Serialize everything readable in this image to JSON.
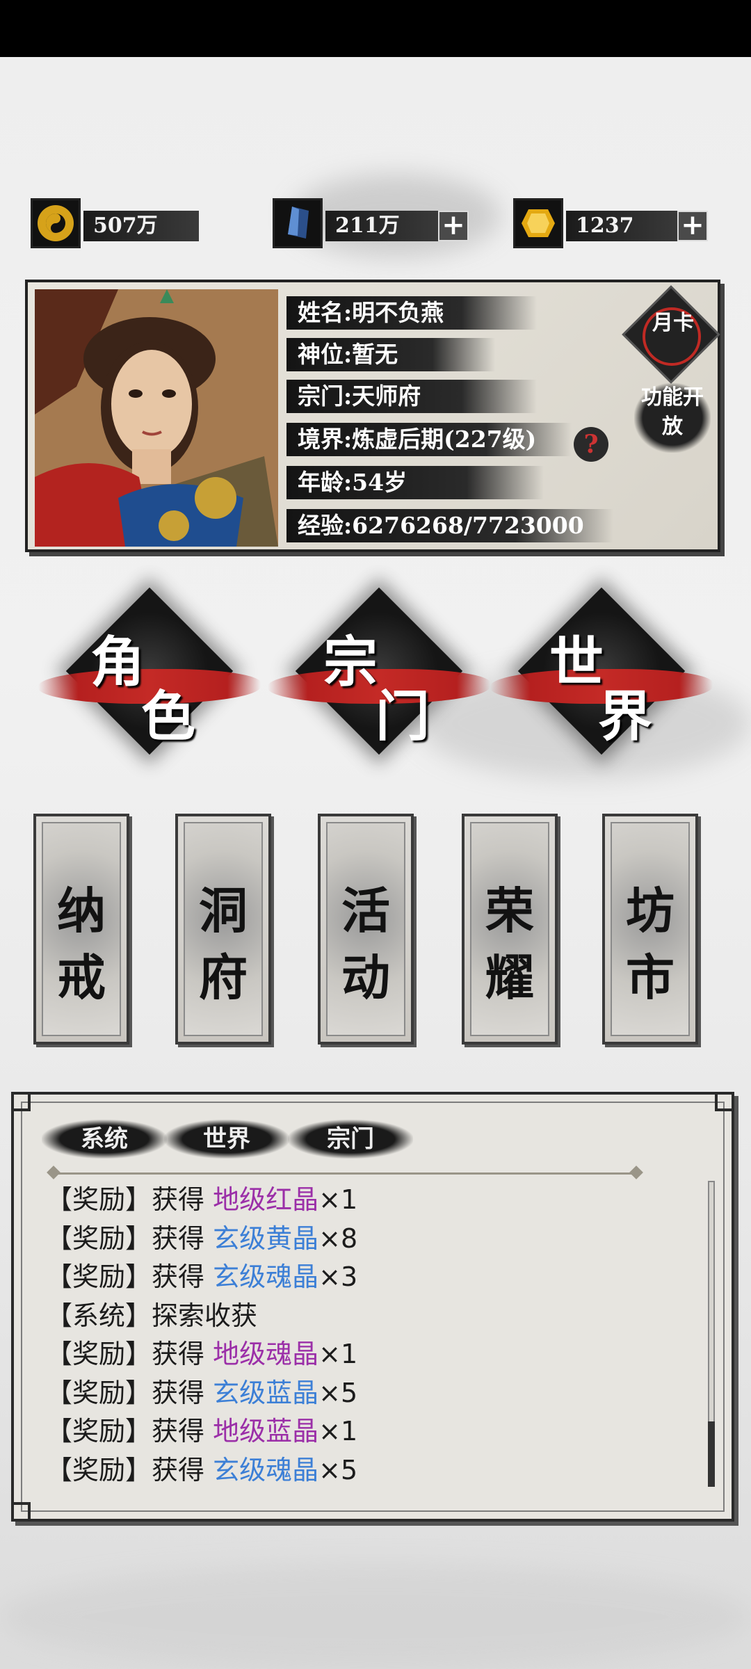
{
  "resources": [
    {
      "icon": "taiji-coin-icon",
      "value": "507万",
      "plus": false
    },
    {
      "icon": "blue-crystal-icon",
      "value": "211万",
      "plus": true
    },
    {
      "icon": "gold-gem-icon",
      "value": "1237",
      "plus": true
    }
  ],
  "resource_plus_symbol": "+",
  "profile": {
    "name": "姓名:明不负燕",
    "divine_rank": "神位:暂无",
    "sect": "宗门:天师府",
    "realm": "境界:炼虚后期(227级)",
    "age": "年龄:54岁",
    "exp": "经验:6276268/7723000",
    "help": "?",
    "month_card": "月卡",
    "function_open": "功能开放"
  },
  "main_menu": [
    {
      "id": "character",
      "top": "角",
      "bottom": "色"
    },
    {
      "id": "sect",
      "top": "宗",
      "bottom": "门"
    },
    {
      "id": "world",
      "top": "世",
      "bottom": "界"
    }
  ],
  "sub_menu": [
    {
      "id": "storage-ring",
      "c1": "纳",
      "c2": "戒"
    },
    {
      "id": "cave-dwelling",
      "c1": "洞",
      "c2": "府"
    },
    {
      "id": "events",
      "c1": "活",
      "c2": "动"
    },
    {
      "id": "glory",
      "c1": "荣",
      "c2": "耀"
    },
    {
      "id": "market",
      "c1": "坊",
      "c2": "市"
    }
  ],
  "chat": {
    "tabs": [
      "系统",
      "世界",
      "宗门"
    ],
    "messages": [
      {
        "tag": "【奖励】",
        "verb": "获得 ",
        "item": "地级红晶",
        "qty": "×1",
        "color": "#9b2fa8"
      },
      {
        "tag": "【奖励】",
        "verb": "获得 ",
        "item": "玄级黄晶",
        "qty": "×8",
        "color": "#3c7fd6"
      },
      {
        "tag": "【奖励】",
        "verb": "获得 ",
        "item": "玄级魂晶",
        "qty": "×3",
        "color": "#3c7fd6"
      },
      {
        "tag": "【系统】",
        "verb": "探索收获",
        "item": "",
        "qty": "",
        "color": "#1c1c1c"
      },
      {
        "tag": "【奖励】",
        "verb": "获得 ",
        "item": "地级魂晶",
        "qty": "×1",
        "color": "#9b2fa8"
      },
      {
        "tag": "【奖励】",
        "verb": "获得 ",
        "item": "玄级蓝晶",
        "qty": "×5",
        "color": "#3c7fd6"
      },
      {
        "tag": "【奖励】",
        "verb": "获得 ",
        "item": "地级蓝晶",
        "qty": "×1",
        "color": "#9b2fa8"
      },
      {
        "tag": "【奖励】",
        "verb": "获得 ",
        "item": "玄级魂晶",
        "qty": "×5",
        "color": "#3c7fd6"
      }
    ]
  },
  "colors": {
    "earth_grade": "#9b2fa8",
    "mystic_grade": "#3c7fd6",
    "accent_red": "#c42a26"
  }
}
